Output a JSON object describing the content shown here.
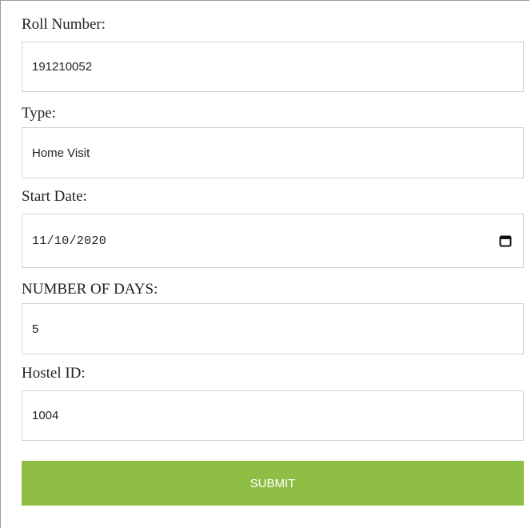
{
  "form": {
    "roll_number": {
      "label": "Roll Number:",
      "value": "191210052"
    },
    "type": {
      "label": "Type:",
      "value": "Home Visit"
    },
    "start_date": {
      "label": "Start Date:",
      "value": "11/10/2020",
      "icon": "calendar-icon"
    },
    "number_of_days": {
      "label": "NUMBER OF DAYS:",
      "value": "5"
    },
    "hostel_id": {
      "label": "Hostel ID:",
      "value": "1004"
    },
    "submit_label": "SUBMIT"
  },
  "colors": {
    "submit_background": "#8fbe45",
    "submit_text": "#ffffff",
    "field_border": "#d4d4d4"
  }
}
